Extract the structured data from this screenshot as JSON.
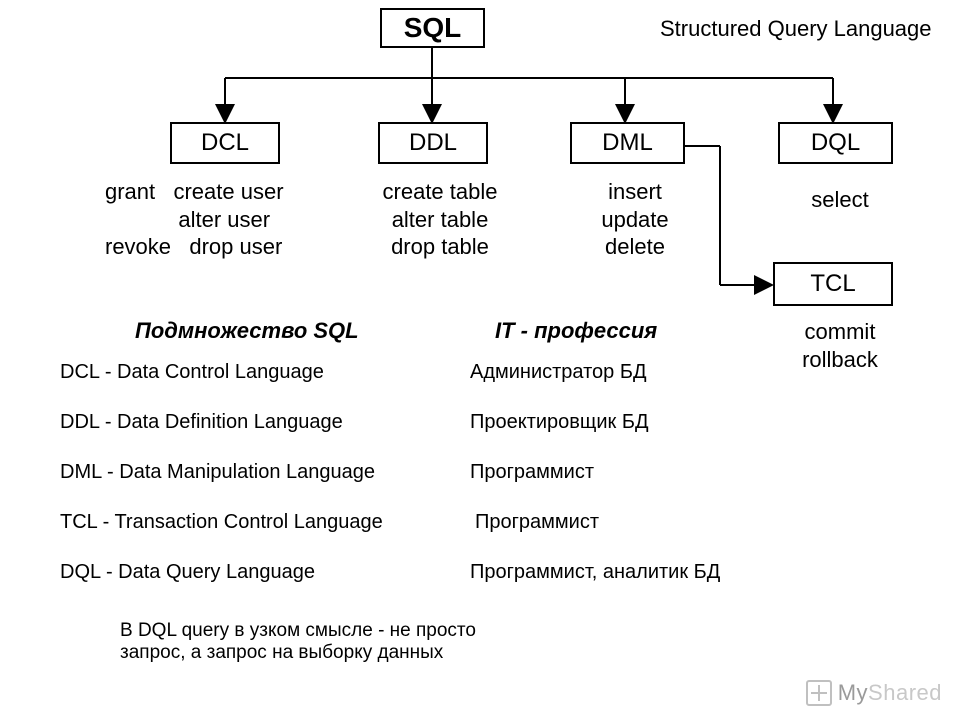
{
  "root": {
    "label": "SQL",
    "subtitle": "Structured Query Language"
  },
  "children": [
    {
      "id": "dcl",
      "label": "DCL",
      "ops": "grant   create user\n            alter user\nrevoke   drop user"
    },
    {
      "id": "ddl",
      "label": "DDL",
      "ops": "create table\nalter table\ndrop table"
    },
    {
      "id": "dml",
      "label": "DML",
      "ops": "insert\nupdate\ndelete"
    },
    {
      "id": "dql",
      "label": "DQL",
      "ops": "select"
    }
  ],
  "tcl": {
    "label": "TCL",
    "ops": "commit\nrollback"
  },
  "section_headings": {
    "subset": "Подмножество SQL",
    "profession": "IT - профессия"
  },
  "definitions": [
    "DCL - Data Control Language",
    "DDL - Data Definition Language",
    "DML - Data Manipulation Language",
    "TCL - Transaction Control Language",
    "DQL - Data Query Language"
  ],
  "professions": [
    "Администратор БД",
    "Проектировщик БД",
    "Программист",
    "Программист",
    "Программист, аналитик БД"
  ],
  "note": "В DQL query в узком смысле - не просто\nзапрос, а запрос на выборку данных",
  "watermark": {
    "my": "My",
    "shared": "Shared"
  }
}
